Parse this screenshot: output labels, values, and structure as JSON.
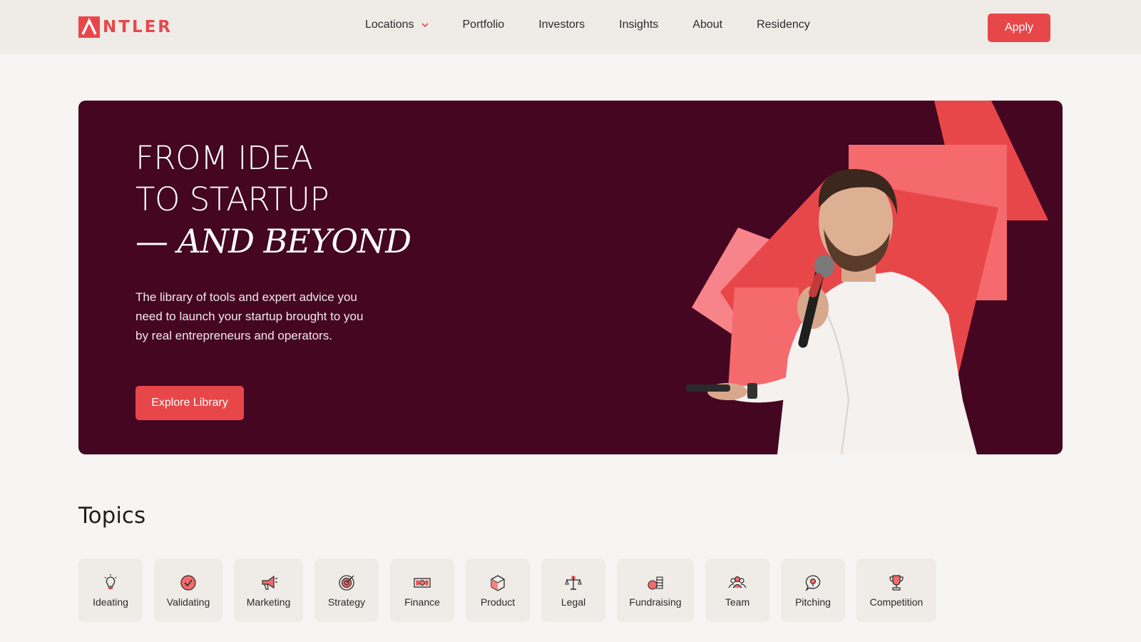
{
  "header": {
    "brand_rest": "NTLER",
    "brand_initial": "A",
    "nav": [
      {
        "label": "Locations",
        "has_dropdown": true
      },
      {
        "label": "Portfolio"
      },
      {
        "label": "Investors"
      },
      {
        "label": "Insights"
      },
      {
        "label": "About"
      },
      {
        "label": "Residency"
      }
    ],
    "apply_label": "Apply"
  },
  "hero": {
    "title_line1": "FROM IDEA",
    "title_line2": "TO STARTUP",
    "title_italic": "— AND BEYOND",
    "description": "The library of tools and expert advice you need to launch your startup brought to you by real entrepreneurs and operators.",
    "cta_label": "Explore Library"
  },
  "topics": {
    "heading": "Topics",
    "items": [
      {
        "label": "Ideating",
        "icon": "lightbulb-icon"
      },
      {
        "label": "Validating",
        "icon": "check-circle-icon"
      },
      {
        "label": "Marketing",
        "icon": "megaphone-icon"
      },
      {
        "label": "Strategy",
        "icon": "target-icon"
      },
      {
        "label": "Finance",
        "icon": "banknote-icon"
      },
      {
        "label": "Product",
        "icon": "box-icon"
      },
      {
        "label": "Legal",
        "icon": "scales-icon"
      },
      {
        "label": "Fundraising",
        "icon": "coins-icon"
      },
      {
        "label": "Team",
        "icon": "people-icon"
      },
      {
        "label": "Pitching",
        "icon": "speech-bulb-icon"
      },
      {
        "label": "Competition",
        "icon": "trophy-icon"
      }
    ]
  },
  "colors": {
    "accent": "#e8474a",
    "hero_bg": "#440621",
    "header_bg": "#efebe7",
    "page_bg": "#f6f5f3"
  }
}
